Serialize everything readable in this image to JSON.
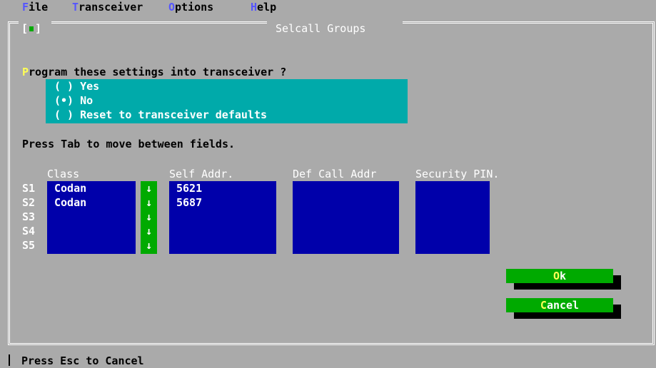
{
  "menu": [
    {
      "hot": "F",
      "rest": "ile"
    },
    {
      "hot": "T",
      "rest": "ransceiver"
    },
    {
      "hot": "O",
      "rest": "ptions"
    },
    {
      "hot": "H",
      "rest": "elp"
    }
  ],
  "window": {
    "title": "Selcall Groups",
    "close_left": "[",
    "close_right": "]"
  },
  "program": {
    "question_hot": "P",
    "question_rest": "rogram these settings into transceiver ?",
    "options": [
      "( ) Yes",
      "(•) No",
      "( ) Reset to transceiver defaults"
    ]
  },
  "hint": "Press Tab to move between fields.",
  "table": {
    "headers": [
      "Class",
      "Self Addr.",
      "Def Call Addr",
      "Security PIN."
    ],
    "rows": [
      {
        "label": "S1",
        "class": "Codan",
        "self_addr": "5621",
        "def_call": "",
        "pin": ""
      },
      {
        "label": "S2",
        "class": "Codan",
        "self_addr": "5687",
        "def_call": "",
        "pin": ""
      },
      {
        "label": "S3",
        "class": "",
        "self_addr": "",
        "def_call": "",
        "pin": ""
      },
      {
        "label": "S4",
        "class": "",
        "self_addr": "",
        "def_call": "",
        "pin": ""
      },
      {
        "label": "S5",
        "class": "",
        "self_addr": "",
        "def_call": "",
        "pin": ""
      }
    ],
    "dropdown_arrow": "↓"
  },
  "buttons": {
    "ok_hot": "O",
    "ok_rest": "k",
    "cancel_hot": "C",
    "cancel_rest": "ancel"
  },
  "status": "Press Esc to Cancel",
  "colors": {
    "background": "#aaaaaa",
    "field": "#0000aa",
    "radio_group": "#00aaaa",
    "button": "#00aa00",
    "hotkey_menu": "#5555ff",
    "hotkey_button": "#ffff55"
  }
}
